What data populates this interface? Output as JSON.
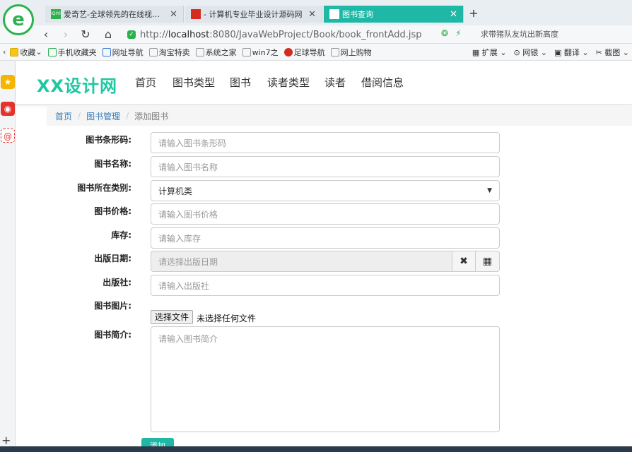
{
  "browser": {
    "logo": "e",
    "tabs": [
      {
        "title": "爱奇艺-全球领先的在线视频网站",
        "badge": "iQIYI",
        "active": false
      },
      {
        "title": "- 计算机专业毕业设计源码网",
        "active": false
      },
      {
        "title": "图书查询",
        "active": true
      }
    ],
    "new_tab": "+",
    "url_scheme": "http://",
    "url_host": "localhost",
    "url_path": ":8080/JavaWebProject/Book/book_frontAdd.jsp",
    "suggest": "求带猪队友坑出新高度",
    "bookmarks": [
      "收藏",
      "手机收藏夹",
      "网址导航",
      "淘宝特卖",
      "系统之家",
      "win7之",
      "足球导航",
      "网上购物"
    ],
    "bookmarks_right": [
      "扩展",
      "网银",
      "翻译",
      "截图"
    ],
    "nav_back": "‹",
    "nav_forward": "›",
    "nav_reload": "↻",
    "nav_home": "⌂"
  },
  "site": {
    "brand": "XX设计网",
    "nav": [
      "首页",
      "图书类型",
      "图书",
      "读者类型",
      "读者",
      "借阅信息"
    ]
  },
  "breadcrumb": {
    "home": "首页",
    "section": "图书管理",
    "current": "添加图书"
  },
  "form": {
    "barcode_label": "图书条形码:",
    "barcode_placeholder": "请输入图书条形码",
    "name_label": "图书名称:",
    "name_placeholder": "请输入图书名称",
    "category_label": "图书所在类别:",
    "category_value": "计算机类",
    "price_label": "图书价格:",
    "price_placeholder": "请输入图书价格",
    "stock_label": "库存:",
    "stock_placeholder": "请输入库存",
    "date_label": "出版日期:",
    "date_placeholder": "请选择出版日期",
    "publisher_label": "出版社:",
    "publisher_placeholder": "请输入出版社",
    "photo_label": "图书图片:",
    "file_button": "选择文件",
    "file_status": "未选择任何文件",
    "intro_label": "图书简介:",
    "intro_placeholder": "请输入图书简介",
    "submit": "添加"
  },
  "colors": {
    "accent": "#1fb8a6",
    "brand": "#1fc7a1",
    "link": "#337ab7"
  }
}
